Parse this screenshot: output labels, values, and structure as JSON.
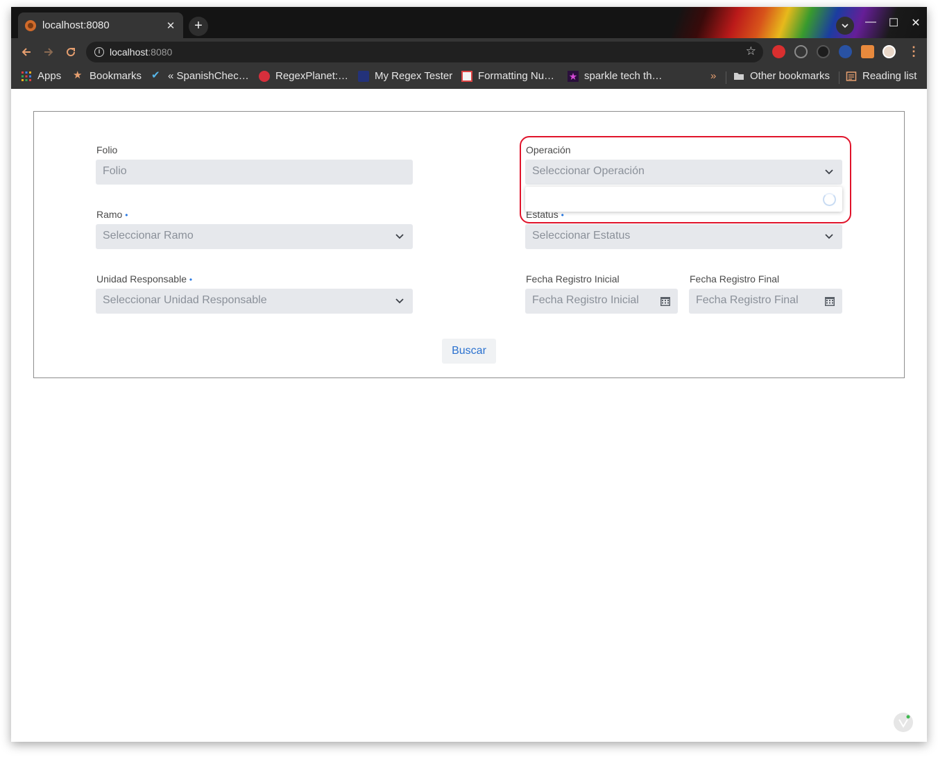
{
  "browser": {
    "tab_title": "localhost:8080",
    "url_host": "localhost",
    "url_port": ":8080",
    "new_tab_glyph": "+",
    "close_glyph": "✕",
    "window_controls": [
      "—",
      "☐",
      "✕"
    ]
  },
  "bookmarks": {
    "items": [
      {
        "label": "Apps",
        "icon": "apps-grid-icon"
      },
      {
        "label": "Bookmarks",
        "icon": "star-icon"
      },
      {
        "label": "« SpanishChec…",
        "icon": "check-icon"
      },
      {
        "label": "RegexPlanet:…",
        "icon": "regexplanet-icon"
      },
      {
        "label": "My Regex Tester",
        "icon": "regex-tester-icon"
      },
      {
        "label": "Formatting Nu…",
        "icon": "formatting-icon"
      },
      {
        "label": "sparkle tech th…",
        "icon": "sparkle-icon"
      }
    ],
    "overflow_glyph": "»",
    "other_bookmarks": "Other bookmarks",
    "reading_list": "Reading list"
  },
  "form": {
    "folio": {
      "label": "Folio",
      "placeholder": "Folio"
    },
    "operacion": {
      "label": "Operación",
      "placeholder": "Seleccionar Operación"
    },
    "ramo": {
      "label": "Ramo",
      "required": "•",
      "placeholder": "Seleccionar Ramo"
    },
    "estatus": {
      "label": "Estatus",
      "required": "•",
      "placeholder": "Seleccionar Estatus"
    },
    "unidad": {
      "label": "Unidad Responsable",
      "required": "•",
      "placeholder": "Seleccionar Unidad Responsable"
    },
    "fecha_inicial": {
      "label": "Fecha Registro Inicial",
      "placeholder": "Fecha Registro Inicial"
    },
    "fecha_final": {
      "label": "Fecha Registro Final",
      "placeholder": "Fecha Registro Final"
    },
    "search_button": "Buscar"
  },
  "colors": {
    "accent": "#2a71cf",
    "highlight": "#e0132a",
    "field_bg": "#e6e8ec"
  }
}
